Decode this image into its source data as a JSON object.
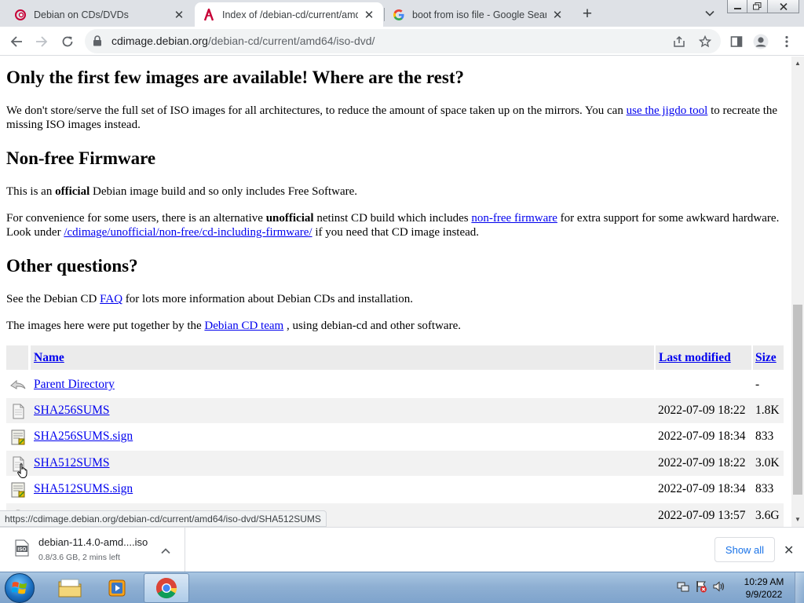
{
  "tabs": [
    {
      "title": "Debian on CDs/DVDs",
      "icon": "debian-logo-icon",
      "active": false
    },
    {
      "title": "Index of /debian-cd/current/amd",
      "icon": "debian-red-icon",
      "active": true
    },
    {
      "title": "boot from iso file - Google Searc",
      "icon": "google-g-icon",
      "active": false
    }
  ],
  "address_bar": {
    "host": "cdimage.debian.org",
    "path": "/debian-cd/current/amd64/iso-dvd/"
  },
  "page": {
    "section1": {
      "heading": "Only the first few images are available! Where are the rest?",
      "para_before_link": "We don't store/serve the full set of ISO images for all architectures, to reduce the amount of space taken up on the mirrors. You can ",
      "link": "use the jigdo tool",
      "para_after_link": " to recreate the missing ISO images instead."
    },
    "section2": {
      "heading": "Non-free Firmware",
      "p1_pre": "This is an ",
      "p1_bold": "official",
      "p1_post": " Debian image build and so only includes Free Software.",
      "p2_pre": "For convenience for some users, there is an alternative ",
      "p2_bold": "unofficial",
      "p2_mid": " netinst CD build which includes ",
      "p2_link1": "non-free firmware",
      "p2_mid2": " for extra support for some awkward hardware. Look under ",
      "p2_link2": "/cdimage/unofficial/non-free/cd-including-firmware/",
      "p2_post": " if you need that CD image instead."
    },
    "section3": {
      "heading": "Other questions?",
      "p1_pre": "See the Debian CD ",
      "p1_link": "FAQ",
      "p1_post": " for lots more information about Debian CDs and installation.",
      "p2_pre": "The images here were put together by the ",
      "p2_link": "Debian CD team",
      "p2_post": " , using debian-cd and other software."
    }
  },
  "listing": {
    "headers": {
      "name": "Name",
      "last_modified": "Last modified",
      "size": "Size"
    },
    "rows": [
      {
        "icon": "back-icon",
        "name": "Parent Directory",
        "modified": "",
        "size": "-"
      },
      {
        "icon": "text-file-icon",
        "name": "SHA256SUMS",
        "modified": "2022-07-09 18:22",
        "size": "1.8K"
      },
      {
        "icon": "signature-file-icon",
        "name": "SHA256SUMS.sign",
        "modified": "2022-07-09 18:34",
        "size": "833"
      },
      {
        "icon": "text-file-icon",
        "name": "SHA512SUMS",
        "modified": "2022-07-09 18:22",
        "size": "3.0K"
      },
      {
        "icon": "signature-file-icon",
        "name": "SHA512SUMS.sign",
        "modified": "2022-07-09 18:34",
        "size": "833"
      },
      {
        "icon": "disc-image-icon",
        "name": "",
        "modified": "2022-07-09 13:57",
        "size": "3.6G"
      }
    ]
  },
  "status_bubble": "https://cdimage.debian.org/debian-cd/current/amd64/iso-dvd/SHA512SUMS",
  "download": {
    "filename": "debian-11.4.0-amd....iso",
    "status": "0.8/3.6 GB, 2 mins left",
    "file_icon_label": "ISO",
    "show_all": "Show all"
  },
  "taskbar": {
    "time": "10:29 AM",
    "date": "9/9/2022"
  }
}
